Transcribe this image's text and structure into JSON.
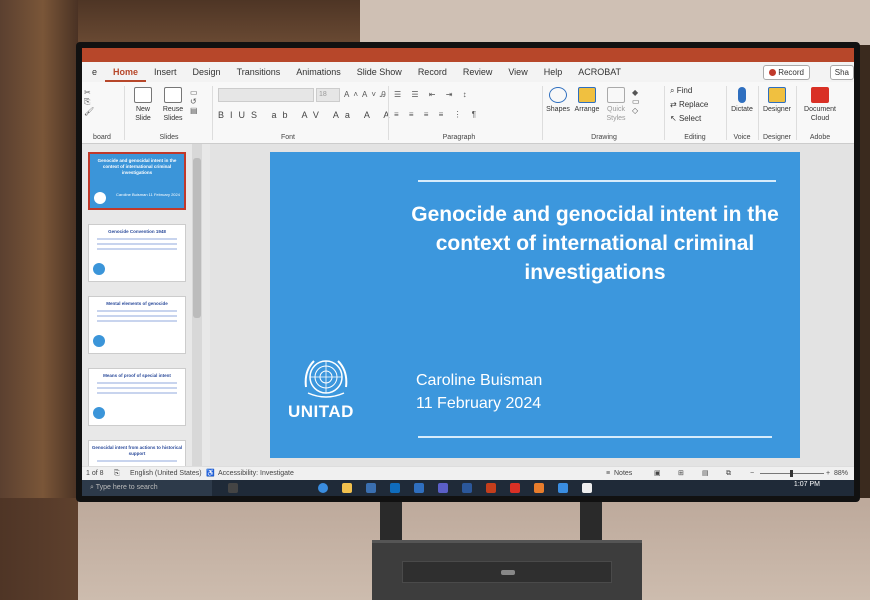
{
  "window": {
    "title": "",
    "share_label": "Sha",
    "record_label": "Record"
  },
  "tabs": [
    "e",
    "Home",
    "Insert",
    "Design",
    "Transitions",
    "Animations",
    "Slide Show",
    "Record",
    "Review",
    "View",
    "Help",
    "ACROBAT"
  ],
  "ribbon": {
    "new_slide": "New Slide",
    "reuse_slides": "Reuse Slides",
    "slides_group": "Slides",
    "clipboard_group": "board",
    "font_group": "Font",
    "font_size": "18",
    "paragraph_group": "Paragraph",
    "shapes": "Shapes",
    "arrange": "Arrange",
    "quick_styles": "Quick Styles",
    "drawing_group": "Drawing",
    "find": "Find",
    "replace": "Replace",
    "select": "Select",
    "editing_group": "Editing",
    "dictate": "Dictate",
    "voice_group": "Voice",
    "designer": "Designer",
    "designer_group": "Designer",
    "document_cloud": "Document Cloud",
    "adobe_group": "Adobe"
  },
  "thumbnails": [
    {
      "title": "Genocide and genocidal intent in the context of international criminal investigations",
      "sub": "Caroline Buisman 11 February 2024",
      "selected": true
    },
    {
      "title": "Genocide Convention 1948",
      "selected": false
    },
    {
      "title": "Mental elements of genocide",
      "selected": false
    },
    {
      "title": "Means of proof of special intent",
      "selected": false
    },
    {
      "title": "Genocidal intent from actions to historical support",
      "selected": false
    }
  ],
  "slide": {
    "title": "Genocide and genocidal intent in the context of international criminal investigations",
    "presenter": "Caroline Buisman",
    "date": "11 February 2024",
    "org": "UNITAD",
    "bg_color": "#3c97dd"
  },
  "status": {
    "slide_count": "1 of 8",
    "language": "English (United States)",
    "accessibility": "Accessibility: Investigate",
    "notes": "Notes",
    "zoom": "88%"
  },
  "taskbar": {
    "search_placeholder": "Type here to search",
    "time": "1:07 PM"
  }
}
